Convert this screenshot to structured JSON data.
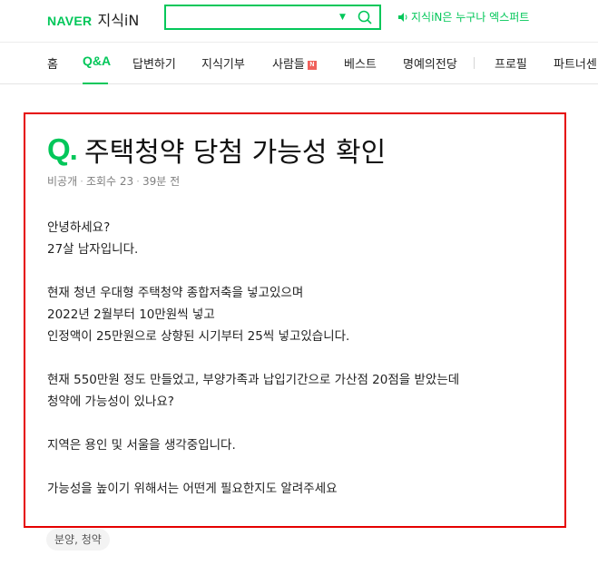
{
  "header": {
    "logo_naver": "NAVER",
    "logo_service": "지식iN",
    "search_value": "",
    "notice": "지식iN은 누구나 엑스퍼트"
  },
  "nav": {
    "items": [
      {
        "label": "홈"
      },
      {
        "label": "Q&A"
      },
      {
        "label": "답변하기"
      },
      {
        "label": "지식기부"
      },
      {
        "label": "사람들"
      },
      {
        "label": "베스트"
      },
      {
        "label": "명예의전당"
      },
      {
        "label": "프로필"
      },
      {
        "label": "파트너센"
      }
    ],
    "new_badge": "N",
    "active_color": "#03c75a"
  },
  "question": {
    "q_mark": "Q.",
    "title": "주택청약 당첨 가능성 확인",
    "meta": {
      "visibility": "비공개",
      "views": "조회수 23",
      "time": "39분 전"
    },
    "body_lines": [
      "안녕하세요?",
      "27살 남자입니다.",
      "",
      "현재 청년 우대형 주택청약 종합저축을 넣고있으며",
      "2022년 2월부터 10만원씩 넣고",
      "인정액이 25만원으로 상향된 시기부터 25씩 넣고있습니다.",
      "",
      "현재 550만원 정도 만들었고, 부양가족과 납입기간으로 가산점 20점을 받았는데",
      "청약에 가능성이 있나요?",
      "",
      "지역은 용인 및 서울을 생각중입니다.",
      "",
      "가능성을 높이기 위해서는 어떤게 필요한지도 알려주세요"
    ],
    "tag": "분양, 청약"
  },
  "colors": {
    "brand": "#03c75a",
    "highlight_border": "#e50000"
  }
}
